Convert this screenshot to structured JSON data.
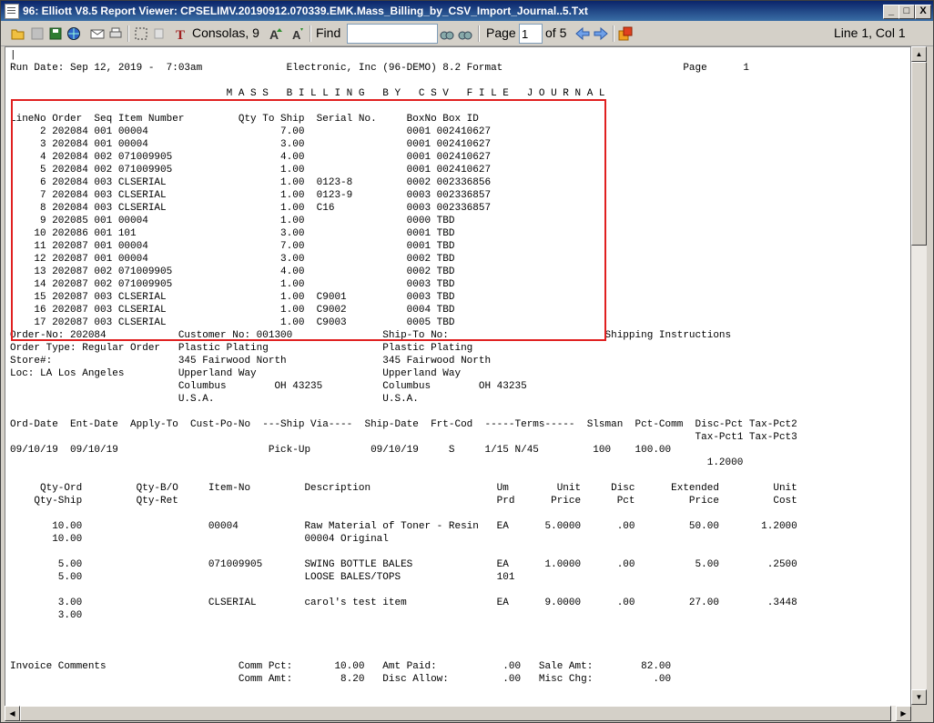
{
  "window": {
    "title": "96: Elliott V8.5 Report Viewer: CPSELIMV.20190912.070339.EMK.Mass_Billing_by_CSV_Import_Journal..5.Txt",
    "minimize": "_",
    "maximize": "□",
    "close": "X"
  },
  "toolbar": {
    "font_name": "Consolas, 9",
    "find_label": "Find",
    "find_value": "",
    "page_label": "Page",
    "page_value": "1",
    "of_pages": "of 5",
    "cursor_position": "Line 1, Col 1"
  },
  "report": {
    "lines": [
      "|",
      "Run Date: Sep 12, 2019 -  7:03am              Electronic, Inc (96-DEMO) 8.2 Format                              Page      1",
      "",
      "                                    M A S S   B I L L I N G   B Y   C S V   F I L E   J O U R N A L",
      "",
      "LineNo Order  Seq Item Number         Qty To Ship  Serial No.     BoxNo Box ID",
      "     2 202084 001 00004                      7.00                 0001 002410627",
      "     3 202084 001 00004                      3.00                 0001 002410627",
      "     4 202084 002 071009905                  4.00                 0001 002410627",
      "     5 202084 002 071009905                  1.00                 0001 002410627",
      "     6 202084 003 CLSERIAL                   1.00  0123-8         0002 002336856",
      "     7 202084 003 CLSERIAL                   1.00  0123-9         0003 002336857",
      "     8 202084 003 CLSERIAL                   1.00  C16            0003 002336857",
      "     9 202085 001 00004                      1.00                 0000 TBD",
      "    10 202086 001 101                        3.00                 0001 TBD",
      "    11 202087 001 00004                      7.00                 0001 TBD",
      "    12 202087 001 00004                      3.00                 0002 TBD",
      "    13 202087 002 071009905                  4.00                 0002 TBD",
      "    14 202087 002 071009905                  1.00                 0003 TBD",
      "    15 202087 003 CLSERIAL                   1.00  C9001          0003 TBD",
      "    16 202087 003 CLSERIAL                   1.00  C9002          0004 TBD",
      "    17 202087 003 CLSERIAL                   1.00  C9003          0005 TBD",
      "Order-No: 202084            Customer No: 001300               Ship-To No:                          Shipping Instructions",
      "Order Type: Regular Order   Plastic Plating                   Plastic Plating",
      "Store#:                     345 Fairwood North                345 Fairwood North",
      "Loc: LA Los Angeles         Upperland Way                     Upperland Way",
      "                            Columbus        OH 43235          Columbus        OH 43235",
      "                            U.S.A.                            U.S.A.",
      "",
      "Ord-Date  Ent-Date  Apply-To  Cust-Po-No  ---Ship Via----  Ship-Date  Frt-Cod  -----Terms-----  Slsman  Pct-Comm  Disc-Pct Tax-Pct2",
      "                                                                                                                  Tax-Pct1 Tax-Pct3",
      "09/10/19  09/10/19                         Pick-Up          09/10/19     S     1/15 N/45         100    100.00",
      "                                                                                                                    1.2000",
      "",
      "     Qty-Ord         Qty-B/O     Item-No         Description                     Um        Unit     Disc      Extended         Unit",
      "    Qty-Ship         Qty-Ret                                                     Prd      Price      Pct         Price         Cost",
      "",
      "       10.00                     00004           Raw Material of Toner - Resin   EA      5.0000      .00         50.00       1.2000",
      "       10.00                                     00004 Original",
      "",
      "        5.00                     071009905       SWING BOTTLE BALES              EA      1.0000      .00          5.00        .2500",
      "        5.00                                     LOOSE BALES/TOPS                101",
      "",
      "        3.00                     CLSERIAL        carol's test item               EA      9.0000      .00         27.00        .3448",
      "        3.00",
      "",
      "",
      "",
      "Invoice Comments                      Comm Pct:       10.00   Amt Paid:           .00   Sale Amt:        82.00",
      "                                      Comm Amt:        8.20   Disc Allow:         .00   Misc Chg:          .00"
    ]
  }
}
